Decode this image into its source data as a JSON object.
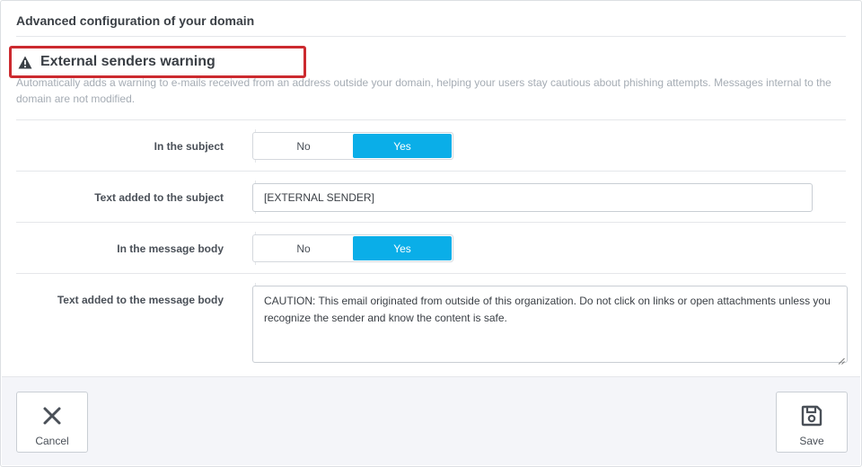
{
  "panel": {
    "title": "Advanced configuration of your domain"
  },
  "section": {
    "icon": "warning-icon",
    "title": "External senders warning",
    "description": "Automatically adds a warning to e-mails received from an address outside your domain, helping your users stay cautious about phishing attempts. Messages internal to the domain are not modified."
  },
  "fields": {
    "subject_toggle": {
      "label": "In the subject",
      "options": [
        "No",
        "Yes"
      ],
      "selected": "Yes"
    },
    "subject_text": {
      "label": "Text added to the subject",
      "value": "[EXTERNAL SENDER]"
    },
    "body_toggle": {
      "label": "In the message body",
      "options": [
        "No",
        "Yes"
      ],
      "selected": "Yes"
    },
    "body_text": {
      "label": "Text added to the message body",
      "value": "CAUTION: This email originated from outside of this organization. Do not click on links or open attachments unless you recognize the sender and know the content is safe."
    }
  },
  "footer": {
    "cancel_label": "Cancel",
    "cancel_icon": "close-icon",
    "save_label": "Save",
    "save_icon": "floppy-disk-icon"
  },
  "colors": {
    "accent": "#0aaee8",
    "highlight_border": "#cc2a2f"
  }
}
